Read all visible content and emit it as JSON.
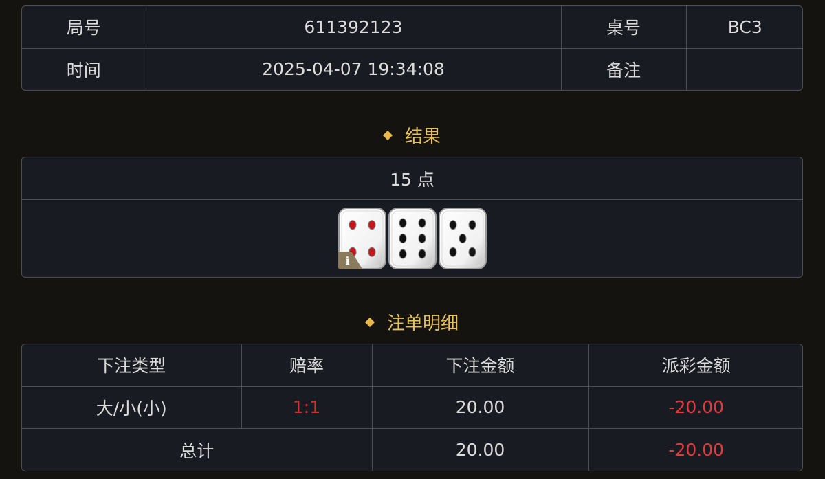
{
  "info": {
    "round_label": "局号",
    "round_value": "611392123",
    "table_label": "桌号",
    "table_value": "BC3",
    "time_label": "时间",
    "time_value": "2025-04-07 19:34:08",
    "note_label": "备注",
    "note_value": ""
  },
  "result": {
    "title": "结果",
    "points_text": "15 点",
    "dice": [
      4,
      6,
      5
    ],
    "info_badge": "i"
  },
  "detail": {
    "title": "注单明细",
    "headers": [
      "下注类型",
      "赔率",
      "下注金额",
      "派彩金额"
    ],
    "rows": [
      {
        "bet_type": "大/小(小)",
        "odds": "1:1",
        "amount": "20.00",
        "payout": "-20.00"
      }
    ],
    "total": {
      "label": "总计",
      "amount": "20.00",
      "payout": "-20.00"
    }
  },
  "colors": {
    "background": "#15130f",
    "panel": "#191b23",
    "border": "#4e4e52",
    "accent_gold": "#e8c15a",
    "loss_red": "#e03a3a"
  }
}
